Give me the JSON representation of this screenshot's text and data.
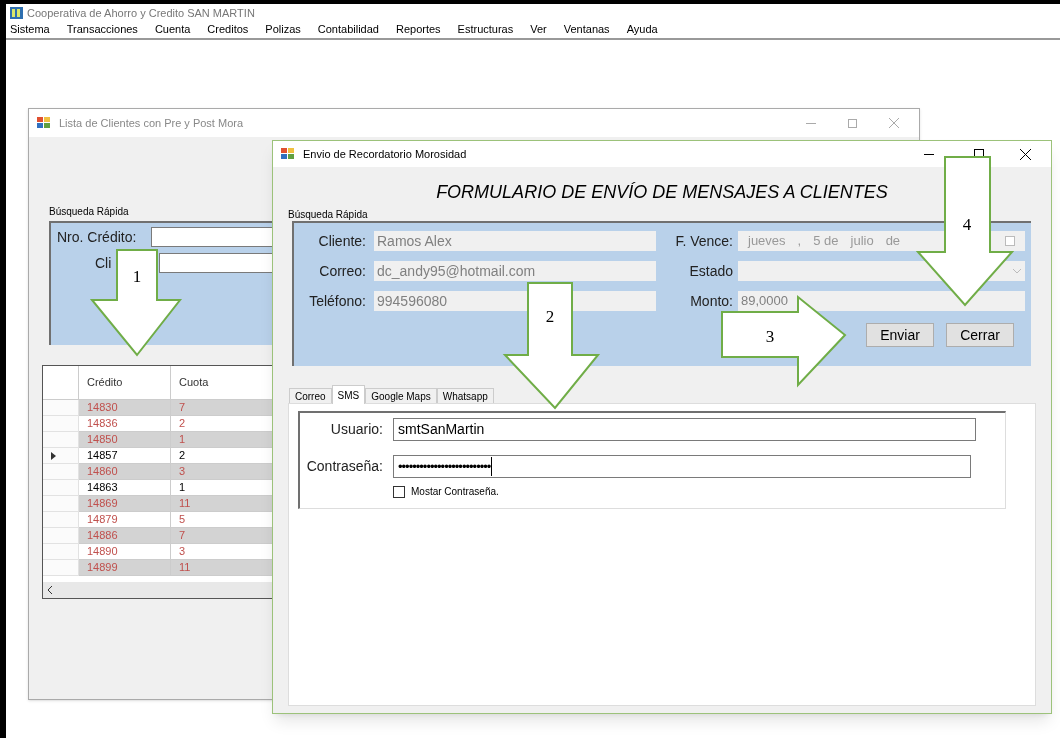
{
  "app": {
    "title": "Cooperativa de Ahorro y Credito SAN MARTIN"
  },
  "menu": [
    "Sistema",
    "Transacciones",
    "Cuenta",
    "Creditos",
    "Polizas",
    "Contabilidad",
    "Reportes",
    "Estructuras",
    "Ver",
    "Ventanas",
    "Ayuda"
  ],
  "list_window": {
    "title": "Lista de Clientes con Pre y Post Mora",
    "group_label": "Búsqueda Rápida",
    "fields": [
      {
        "label": "Nro. Crédito:"
      },
      {
        "label": "Cli"
      }
    ],
    "table": {
      "columns": [
        "Crédito",
        "Cuota"
      ],
      "rows": [
        {
          "cells": [
            "14830",
            "7"
          ],
          "color": "#c0504d",
          "selected": false
        },
        {
          "cells": [
            "14836",
            "2"
          ],
          "color": "#c0504d",
          "selected": false
        },
        {
          "cells": [
            "14850",
            "1"
          ],
          "color": "#c0504d",
          "selected": false
        },
        {
          "cells": [
            "14857",
            "2"
          ],
          "color": "#000000",
          "selected": true
        },
        {
          "cells": [
            "14860",
            "3"
          ],
          "color": "#c0504d",
          "selected": false
        },
        {
          "cells": [
            "14863",
            "1"
          ],
          "color": "#000000",
          "selected": false
        },
        {
          "cells": [
            "14869",
            "11"
          ],
          "color": "#c0504d",
          "selected": false
        },
        {
          "cells": [
            "14879",
            "5"
          ],
          "color": "#c0504d",
          "selected": false
        },
        {
          "cells": [
            "14886",
            "7"
          ],
          "color": "#c0504d",
          "selected": false
        },
        {
          "cells": [
            "14890",
            "3"
          ],
          "color": "#c0504d",
          "selected": false
        },
        {
          "cells": [
            "14899",
            "11"
          ],
          "color": "#c0504d",
          "selected": false
        }
      ]
    }
  },
  "form_window": {
    "title": "Envio de Recordatorio Morosidad",
    "heading": "FORMULARIO DE ENVÍO DE MENSAJES A CLIENTES",
    "group_label": "Búsqueda Rápida",
    "left_fields": [
      {
        "label": "Cliente:",
        "value": "Ramos Alex"
      },
      {
        "label": "Correo:",
        "value": "dc_andy95@hotmail.com"
      },
      {
        "label": "Teléfono:",
        "value": "994596080"
      }
    ],
    "right_fields": [
      {
        "kind": "date",
        "label": "F. Vence:",
        "parts": [
          "jueves",
          ",",
          "5 de",
          "julio",
          "de"
        ]
      },
      {
        "kind": "combo",
        "label": "Estado"
      },
      {
        "kind": "text",
        "label": "Monto:",
        "value": "89,0000"
      }
    ],
    "buttons": [
      "Enviar",
      "Cerrar"
    ],
    "tabs": [
      {
        "label": "Correo",
        "selected": false
      },
      {
        "label": "SMS",
        "selected": true
      },
      {
        "label": "Google Maps",
        "selected": false
      },
      {
        "label": "Whatsapp",
        "selected": false
      }
    ],
    "sms": {
      "fields": [
        {
          "kind": "text",
          "label": "Usuario:",
          "value": "smtSanMartin"
        },
        {
          "kind": "password",
          "label": "Contraseña:",
          "value": "••••••••••••••••••••••••••"
        }
      ],
      "checkbox": {
        "label": "Mostar Contraseña.",
        "checked": false
      }
    }
  },
  "callouts": [
    "1",
    "2",
    "3",
    "4"
  ]
}
